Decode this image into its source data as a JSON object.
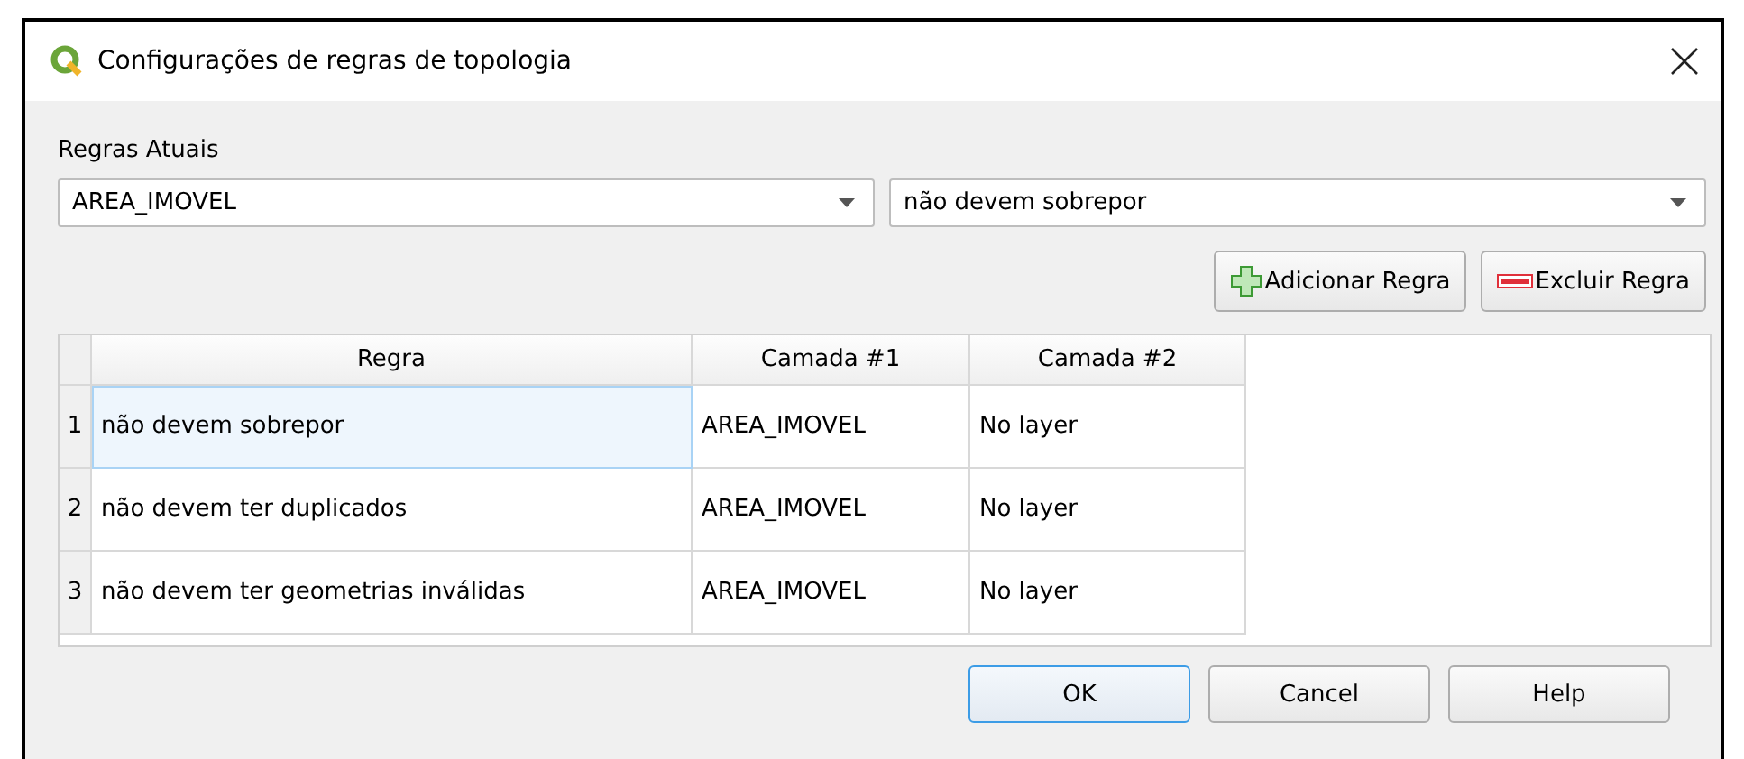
{
  "window": {
    "title": "Configurações de regras de topologia"
  },
  "rules_label": "Regras Atuais",
  "layer_combo": {
    "value": "AREA_IMOVEL"
  },
  "rule_combo": {
    "value": "não devem sobrepor"
  },
  "actions": [
    {
      "kind": "add",
      "label": "Adicionar Regra"
    },
    {
      "kind": "remove",
      "label": "Excluir Regra"
    }
  ],
  "table": {
    "columns": [
      "Regra",
      "Camada #1",
      "Camada #2"
    ],
    "rows": [
      {
        "number": "1",
        "cells": [
          "não devem sobrepor",
          "AREA_IMOVEL",
          "No layer"
        ],
        "selected": true
      },
      {
        "number": "2",
        "cells": [
          "não devem ter duplicados",
          "AREA_IMOVEL",
          "No layer"
        ],
        "selected": false
      },
      {
        "number": "3",
        "cells": [
          "não devem ter geometrias inválidas",
          "AREA_IMOVEL",
          "No layer"
        ],
        "selected": false
      }
    ]
  },
  "buttons": [
    {
      "label": "OK",
      "default": true
    },
    {
      "label": "Cancel",
      "default": false
    },
    {
      "label": "Help",
      "default": false
    }
  ]
}
